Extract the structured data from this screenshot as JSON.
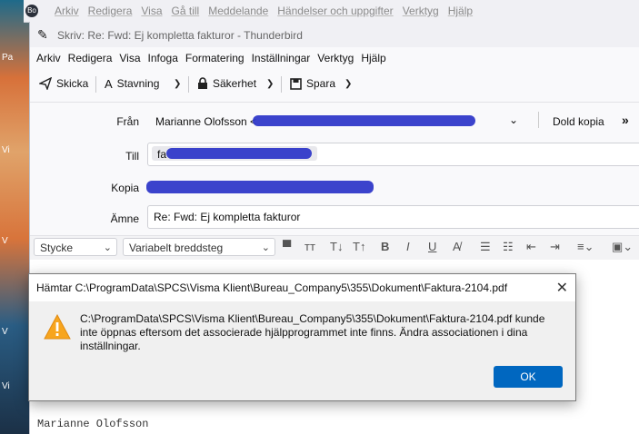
{
  "desktop": {
    "labels": [
      "Pa",
      "Vi",
      "V",
      "V",
      "Vi"
    ]
  },
  "background_window": {
    "app_icon": "Bo",
    "menu": [
      "Arkiv",
      "Redigera",
      "Visa",
      "Gå till",
      "Meddelande",
      "Händelser och uppgifter",
      "Verktyg",
      "Hjälp"
    ]
  },
  "compose": {
    "title": "Skriv: Re: Fwd: Ej kompletta fakturor - Thunderbird",
    "menu": [
      "Arkiv",
      "Redigera",
      "Visa",
      "Infoga",
      "Formatering",
      "Inställningar",
      "Verktyg",
      "Hjälp"
    ],
    "toolbar": {
      "send": "Skicka",
      "spelling": "Stavning",
      "security": "Säkerhet",
      "save": "Spara"
    },
    "headers": {
      "from_label": "Från",
      "from_value": "Marianne Olofsson <",
      "bcc_label": "Dold kopia",
      "to_label": "Till",
      "to_prefix": "fa",
      "cc_label": "Kopia",
      "subject_label": "Ämne",
      "subject_value": "Re: Fwd: Ej kompletta fakturor"
    },
    "format": {
      "paragraph": "Stycke",
      "font": "Variabelt breddsteg"
    },
    "body_lines": [
      "Marianne Olofsson"
    ]
  },
  "dialog": {
    "title": "Hämtar C:\\ProgramData\\SPCS\\Visma Klient\\Bureau_Company5\\355\\Dokument\\Faktura-2104.pdf",
    "message": "C:\\ProgramData\\SPCS\\Visma Klient\\Bureau_Company5\\355\\Dokument\\Faktura-2104.pdf kunde inte öppnas eftersom det associerade hjälpprogrammet inte finns. Ändra associationen i dina inställningar.",
    "ok": "OK",
    "icon": "warning-icon"
  },
  "colors": {
    "accent": "#0067c0",
    "warning": "#f7b500",
    "redaction": "#2a33c8"
  }
}
